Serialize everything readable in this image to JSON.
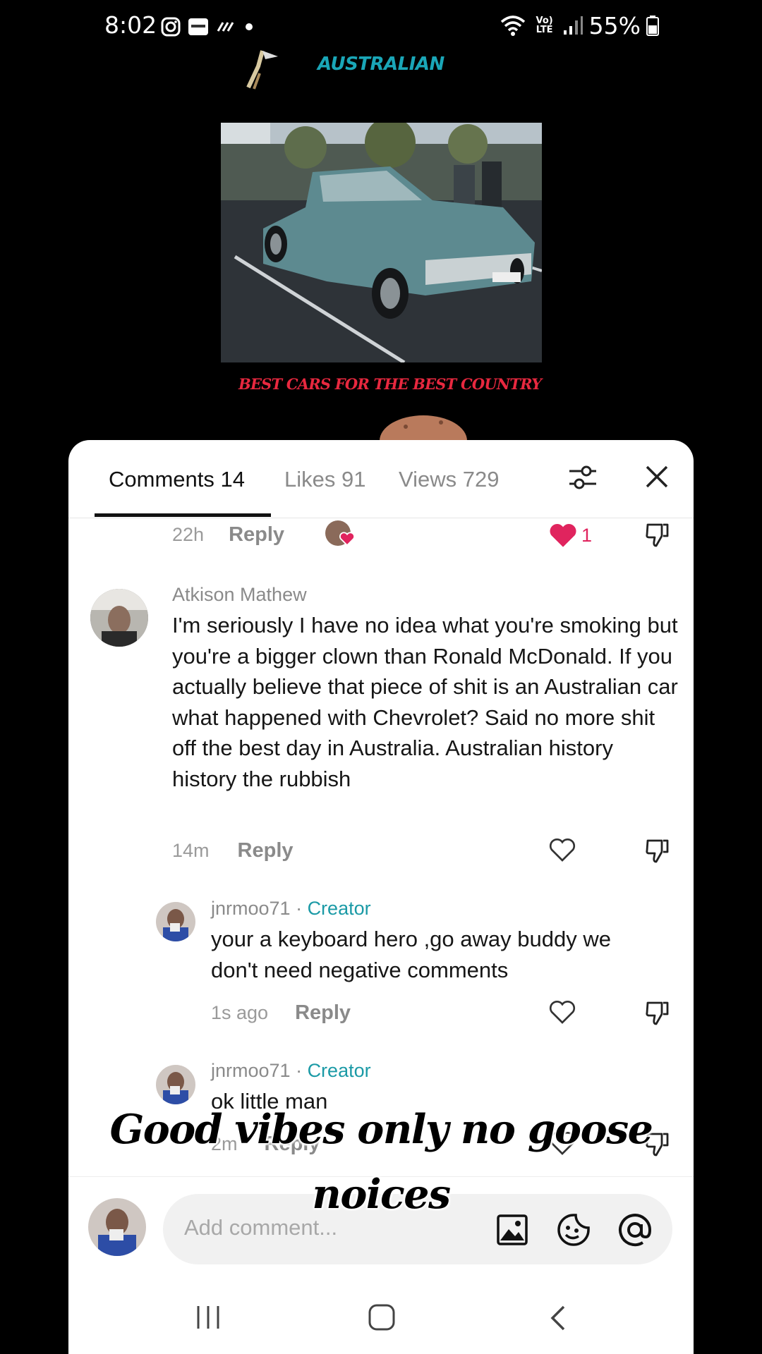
{
  "status_bar": {
    "time": "8:02",
    "battery": "55%",
    "network": "Vo) LTE"
  },
  "video": {
    "header_text": "AUSTRALIAN",
    "caption": "BEST CARS FOR THE BEST COUNTRY"
  },
  "tabs": [
    {
      "label": "Comments 14",
      "active": true
    },
    {
      "label": "Likes 91",
      "active": false
    },
    {
      "label": "Views 729",
      "active": false
    }
  ],
  "comments": {
    "top_row": {
      "time": "22h",
      "reply": "Reply",
      "likes": "1"
    },
    "main": {
      "username": "Atkison Mathew",
      "text": "I'm seriously I have no idea what you're smoking but you're a bigger clown than Ronald McDonald. If you actually believe that piece of shit is an Australian car what happened with Chevrolet? Said no more shit off the best day in Australia. Australian history history the rubbish",
      "time": "14m",
      "reply": "Reply"
    },
    "replies": [
      {
        "username": "jnrmoo71",
        "separator": " · ",
        "badge": "Creator",
        "text": "your a keyboard hero ,go away buddy we don't need negative comments",
        "time": "1s ago",
        "reply": "Reply"
      },
      {
        "username": "jnrmoo71",
        "separator": " · ",
        "badge": "Creator",
        "text": "ok little man",
        "time": "2m",
        "reply": "Reply"
      }
    ]
  },
  "input": {
    "placeholder": "Add comment..."
  },
  "overlay": {
    "line1": "Good vibes only no goose",
    "line2": "noices"
  },
  "colors": {
    "like_red": "#e0245e",
    "creator_teal": "#1b9aa6"
  }
}
